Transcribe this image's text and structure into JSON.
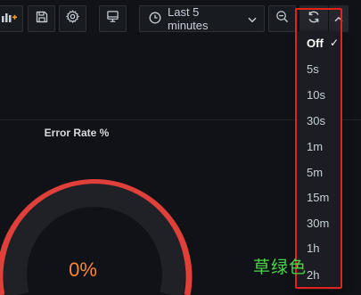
{
  "toolbar": {
    "time_range_label": "Last 5 minutes"
  },
  "panel": {
    "title": "Error Rate %",
    "value": "0%",
    "value_color": "#ff8533",
    "threshold_color": "#e0403a"
  },
  "refresh_menu": {
    "items": [
      {
        "label": "Off",
        "selected": true
      },
      {
        "label": "5s"
      },
      {
        "label": "10s"
      },
      {
        "label": "30s"
      },
      {
        "label": "1m"
      },
      {
        "label": "5m"
      },
      {
        "label": "15m"
      },
      {
        "label": "30m"
      },
      {
        "label": "1h"
      },
      {
        "label": "2h"
      }
    ]
  },
  "icons": {
    "add_panel": "add-panel-icon",
    "save": "save-icon",
    "settings": "gear-icon",
    "tv_mode": "monitor-icon",
    "time": "clock-icon",
    "zoom_out": "zoom-out-icon",
    "refresh": "refresh-icon",
    "collapse": "chevron-up-icon"
  },
  "annotation": {
    "watermark": "草绿色",
    "highlight_color": "#e0241c"
  }
}
